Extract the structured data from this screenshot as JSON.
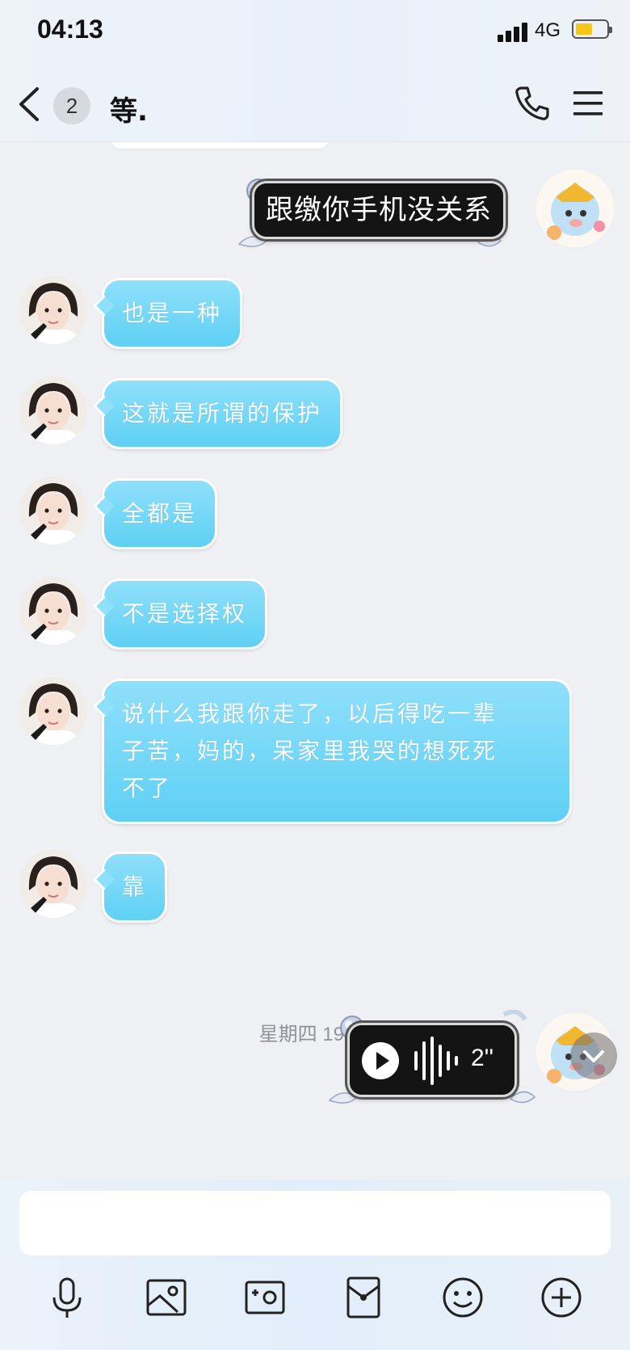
{
  "status": {
    "time": "04:13",
    "network": "4G"
  },
  "header": {
    "unread_count": "2",
    "title": "等."
  },
  "messages": [
    {
      "text": "也是一种"
    },
    {
      "text": "这就是所谓的保护"
    },
    {
      "text": "全都是"
    },
    {
      "text": "不是选择权"
    },
    {
      "line1": "说什么我跟你走了，以后得吃一辈",
      "line2": "子苦，妈的，呆家里我哭的想死死",
      "line3": "不了"
    },
    {
      "text": "靠"
    }
  ],
  "sent": {
    "text_message": "跟缴你手机没关系",
    "voice_duration": "2''"
  },
  "timestamp": "星期四 19:46",
  "input": {
    "placeholder": ""
  },
  "toolbar": [
    "microphone-icon",
    "image-icon",
    "camera-icon",
    "red-packet-icon",
    "emoji-icon",
    "plus-icon"
  ],
  "colors": {
    "bubble": "#5fd0f4",
    "accent_battery": "#f5c518",
    "dark_bubble": "#141414"
  }
}
